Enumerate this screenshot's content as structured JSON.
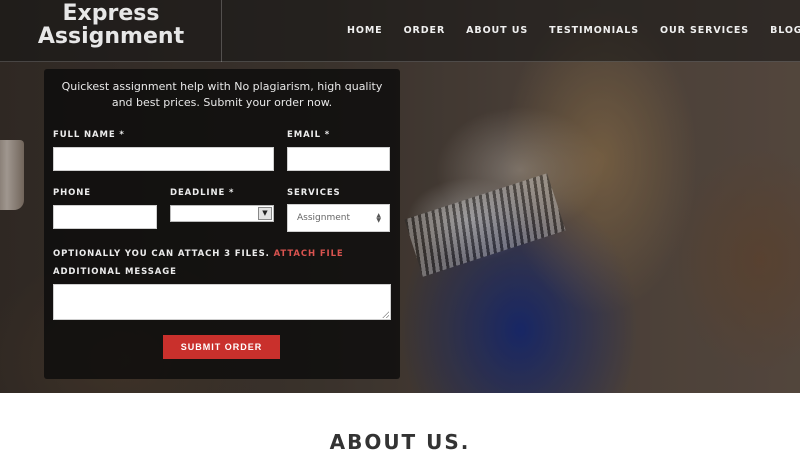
{
  "brand": {
    "line1": "Express",
    "line2": "Assignment"
  },
  "nav": [
    {
      "label": "HOME"
    },
    {
      "label": "ORDER"
    },
    {
      "label": "ABOUT US"
    },
    {
      "label": "TESTIMONIALS"
    },
    {
      "label": "OUR SERVICES"
    },
    {
      "label": "BLOG"
    }
  ],
  "form": {
    "intro": "Quickest assignment help with No plagiarism, high quality and best prices. Submit your order now.",
    "full_name_label": "FULL NAME *",
    "email_label": "EMAIL *",
    "phone_label": "PHONE",
    "deadline_label": "DEADLINE *",
    "services_label": "SERVICES",
    "services_value": "Assignment",
    "attach_text": "OPTIONALLY YOU CAN ATTACH 3 FILES.",
    "attach_link": "ATTACH FILE",
    "message_label": "ADDITIONAL MESSAGE",
    "submit_label": "SUBMIT ORDER",
    "full_name_value": "",
    "email_value": "",
    "phone_value": "",
    "deadline_value": "",
    "message_value": ""
  },
  "about": {
    "title": "ABOUT US."
  },
  "colors": {
    "accent": "#c9302c",
    "link": "#d9534f",
    "panel": "#0a0a0a"
  }
}
